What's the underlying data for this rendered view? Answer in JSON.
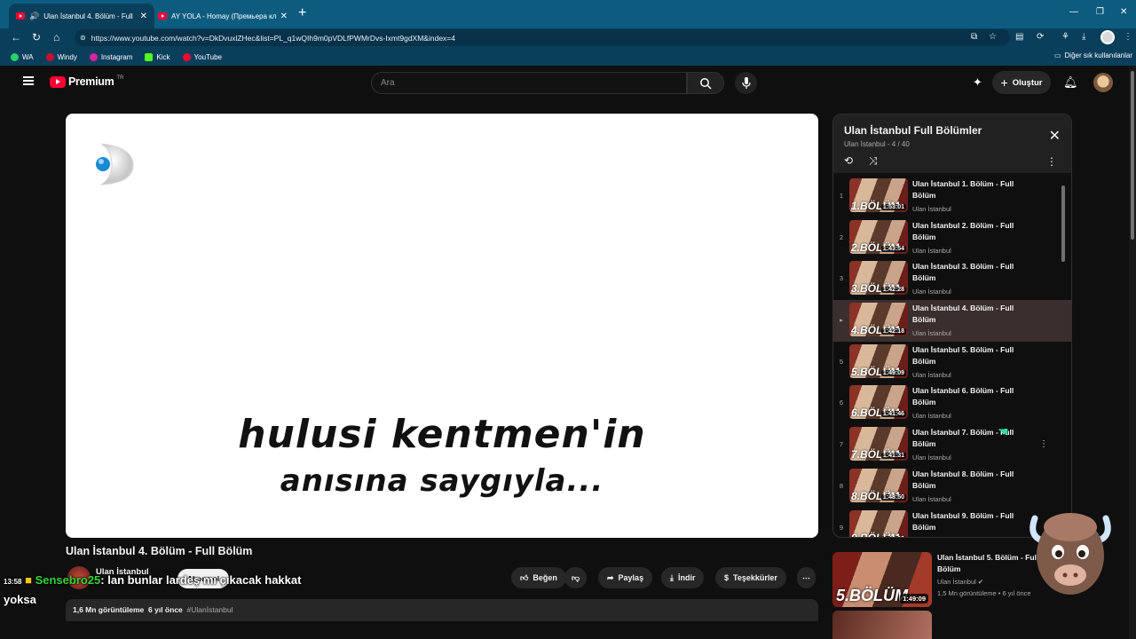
{
  "browser": {
    "tabs": [
      {
        "title": "Ulan İstanbul 4. Bölüm - Full",
        "active": true
      },
      {
        "title": "AY YOLA - Homay (Премьера кл",
        "active": false
      }
    ],
    "url": "https://www.youtube.com/watch?v=DkDvuxlZHec&list=PL_q1wQIh9m0pVDLfPWMrDvs-Ixmt9gdXM&index=4",
    "bookmarks": [
      "WA",
      "Windy",
      "Instagram",
      "Kick",
      "YouTube"
    ],
    "other_bookmarks": "Diğer sık kullanılanlar"
  },
  "youtube": {
    "logo_text": "Premium",
    "logo_badge": "TR",
    "search_placeholder": "Ara",
    "create_label": "Oluştur"
  },
  "video": {
    "overlay_line1": "hulusi kentmen'in",
    "overlay_line2": "anısına saygıyla...",
    "title": "Ulan İstanbul 4. Bölüm - Full Bölüm",
    "channel": "Ulan İstanbul",
    "subscribe_label": "Abone ol",
    "actions": [
      "Beğen",
      "Paylaş",
      "İndir",
      "Teşekkürler"
    ],
    "description": {
      "views": "1,6 Mn görüntüleme",
      "age": "6 yıl önce",
      "hashtag": "#Ulanİstanbul"
    }
  },
  "playlist": {
    "title": "Ulan İstanbul Full Bölümler",
    "subtitle": "Ulan İstanbul - 4 / 40",
    "items": [
      {
        "index": "1",
        "title": "Ulan İstanbul 1. Bölüm - Full Bölüm",
        "channel": "Ulan İstanbul",
        "duration": "1:53:01",
        "ep": "1.BÖLÜM"
      },
      {
        "index": "2",
        "title": "Ulan İstanbul 2. Bölüm - Full Bölüm",
        "channel": "Ulan İstanbul",
        "duration": "1:43:54",
        "ep": "2.BÖLÜM"
      },
      {
        "index": "3",
        "title": "Ulan İstanbul 3. Bölüm - Full Bölüm",
        "channel": "Ulan İstanbul",
        "duration": "1:42:28",
        "ep": "3.BÖLÜM"
      },
      {
        "index": "▸",
        "title": "Ulan İstanbul 4. Bölüm - Full Bölüm",
        "channel": "Ulan İstanbul",
        "duration": "1:42:18",
        "ep": "4.BÖLÜM"
      },
      {
        "index": "5",
        "title": "Ulan İstanbul 5. Bölüm - Full Bölüm",
        "channel": "Ulan İstanbul",
        "duration": "1:49:09",
        "ep": "5.BÖLÜM"
      },
      {
        "index": "6",
        "title": "Ulan İstanbul 6. Bölüm - Full Bölüm",
        "channel": "Ulan İstanbul",
        "duration": "1:41:46",
        "ep": "6.BÖLÜM"
      },
      {
        "index": "7",
        "title": "Ulan İstanbul 7. Bölüm - Full Bölüm",
        "channel": "Ulan İstanbul",
        "duration": "1:41:31",
        "ep": "7.BÖLÜM"
      },
      {
        "index": "8",
        "title": "Ulan İstanbul 8. Bölüm - Full Bölüm",
        "channel": "Ulan İstanbul",
        "duration": "1:48:50",
        "ep": "8.BÖLÜM"
      },
      {
        "index": "9",
        "title": "Ulan İstanbul 9. Bölüm - Full Bölüm",
        "channel": "Ulan İstanbul",
        "duration": "1:42:03",
        "ep": "9.BÖLÜM"
      }
    ]
  },
  "recommended": {
    "title": "Ulan İstanbul 5. Bölüm - Full Bölüm",
    "channel": "Ulan İstanbul",
    "meta": "1,5 Mn görüntüleme • 6 yıl önce",
    "duration": "1:49:09",
    "ep": "5.BÖLÜM"
  },
  "stream_chat": {
    "time": "13:58",
    "user": "Sensebro25",
    "message": ": lan bunlar lardeş mı çıkacak hakkat",
    "line2": "yoksa"
  }
}
